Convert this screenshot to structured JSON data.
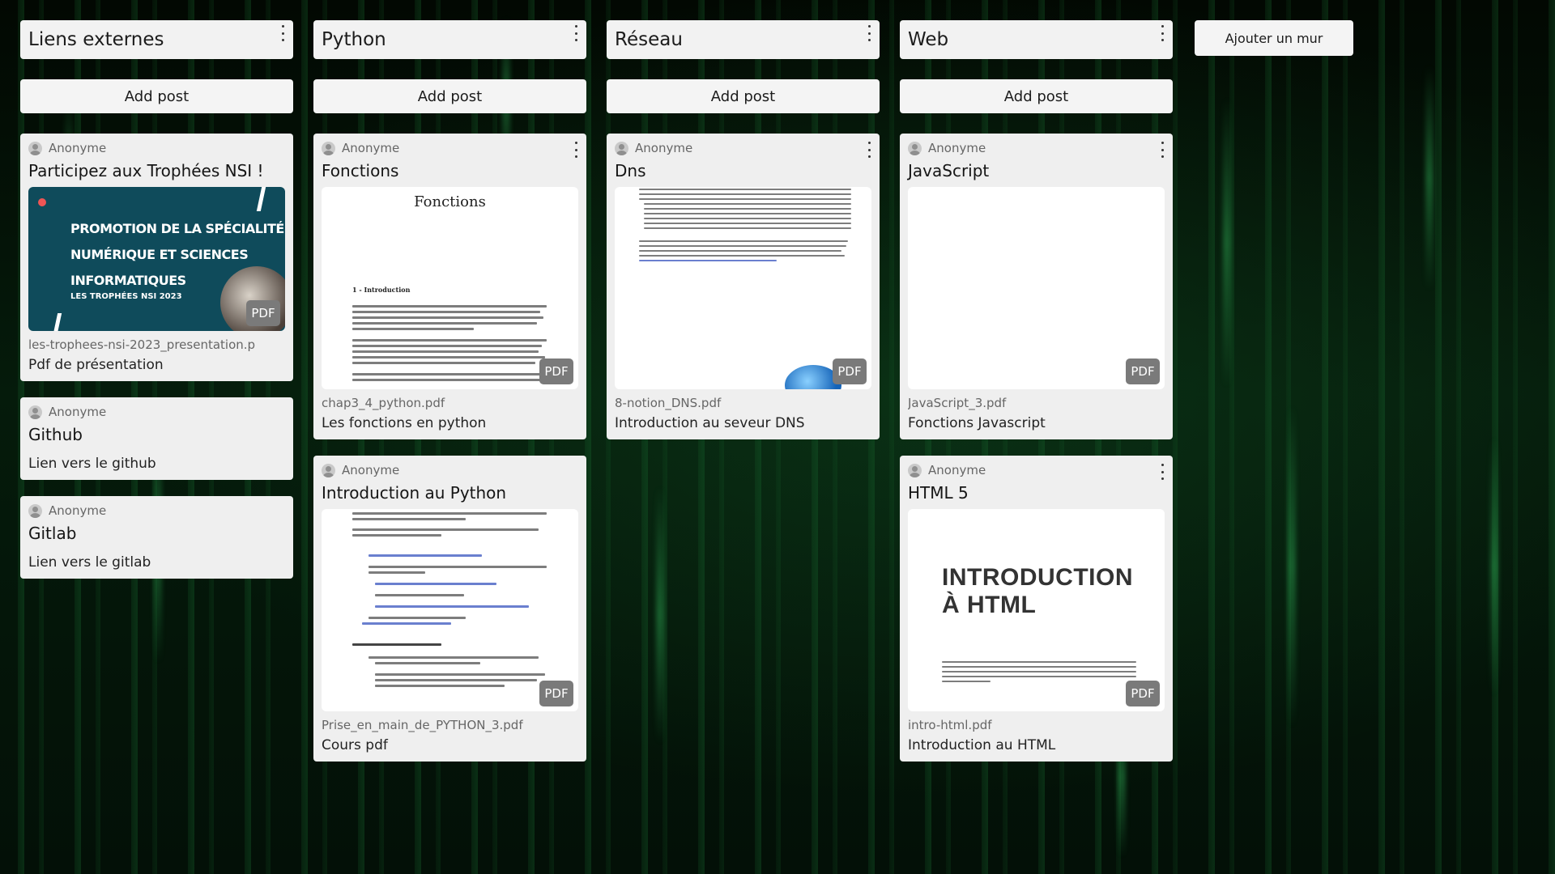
{
  "add_wall_label": "Ajouter un mur",
  "add_post_label": "Add post",
  "walls": [
    {
      "title": "Liens externes",
      "posts": [
        {
          "author": "Anonyme",
          "title": "Participez aux Trophées NSI !",
          "thumb_text": [
            "PROMOTION DE LA SPÉCIALITÉ",
            "NUMÉRIQUE ET SCIENCES",
            "INFORMATIQUES"
          ],
          "thumb_subtext": "LES TROPHÉES NSI 2023",
          "badge": "PDF",
          "filename": "les-trophees-nsi-2023_presentation.p",
          "description": "Pdf de présentation"
        },
        {
          "author": "Anonyme",
          "title": "Github",
          "description": "Lien vers le github"
        },
        {
          "author": "Anonyme",
          "title": "Gitlab",
          "description": "Lien vers le gitlab"
        }
      ]
    },
    {
      "title": "Python",
      "posts": [
        {
          "author": "Anonyme",
          "title": "Fonctions",
          "thumb_heading": "Fonctions",
          "thumb_section": "1 - Introduction",
          "badge": "PDF",
          "filename": "chap3_4_python.pdf",
          "description": "Les fonctions en python"
        },
        {
          "author": "Anonyme",
          "title": "Introduction au Python",
          "badge": "PDF",
          "filename": "Prise_en_main_de_PYTHON_3.pdf",
          "description": "Cours pdf"
        }
      ]
    },
    {
      "title": "Réseau",
      "posts": [
        {
          "author": "Anonyme",
          "title": "Dns",
          "badge": "PDF",
          "filename": "8-notion_DNS.pdf",
          "description": "Introduction au seveur DNS"
        }
      ]
    },
    {
      "title": "Web",
      "posts": [
        {
          "author": "Anonyme",
          "title": "JavaScript",
          "badge": "PDF",
          "filename": "JavaScript_3.pdf",
          "description": "Fonctions Javascript"
        },
        {
          "author": "Anonyme",
          "title": "HTML 5",
          "thumb_heading": [
            "INTRODUCTION",
            "À HTML"
          ],
          "badge": "PDF",
          "filename": "intro-html.pdf",
          "description": "Introduction au HTML"
        }
      ]
    }
  ]
}
